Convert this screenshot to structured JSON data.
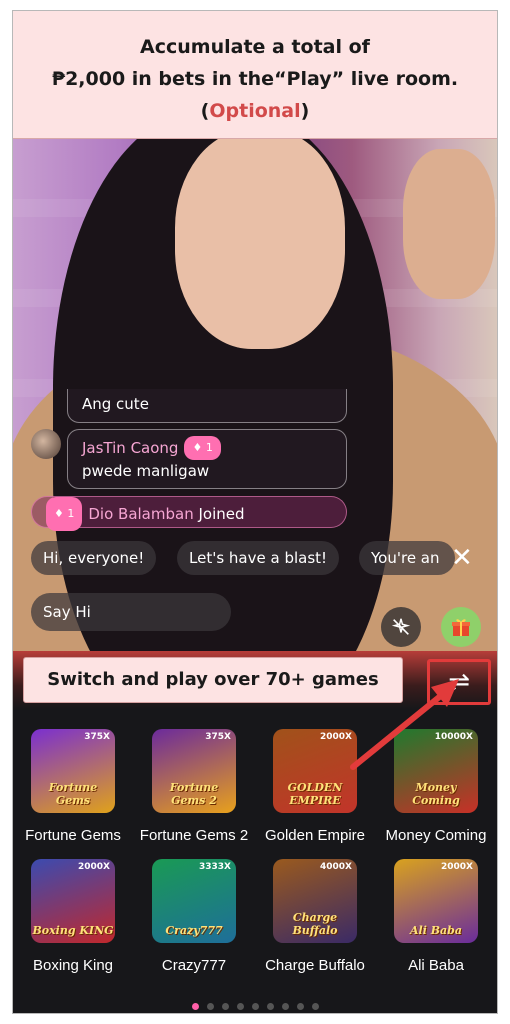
{
  "banner": {
    "line1": "Accumulate a total of",
    "line2": "₱2,000 in bets in the“Play” live room.",
    "line3_open": "(",
    "optional": "Optional",
    "line3_close": ")"
  },
  "chat": {
    "prev_message": "Ang cute",
    "message": {
      "user": "JasTin Caong",
      "level": "1",
      "text": "pwede manligaw"
    },
    "join": {
      "level": "1",
      "user": "Dio Balamban",
      "action": "Joined"
    }
  },
  "quick_replies": [
    "Hi, everyone!",
    "Let's have a blast!",
    "You're an"
  ],
  "close_label": "✕",
  "say_hi": "Say Hi",
  "game_panel": {
    "switch_label": "Switch and play over 70+ games",
    "switch_icon": "⇌",
    "games": [
      {
        "name": "Fortune Gems",
        "logo": "Fortune Gems",
        "tag": "375X",
        "color_top": "#7a2fd0",
        "color_bottom": "#e0a21a"
      },
      {
        "name": "Fortune Gems 2",
        "logo": "Fortune Gems 2",
        "tag": "375X",
        "color_top": "#6b2a9c",
        "color_bottom": "#e8a11c"
      },
      {
        "name": "Golden Empire",
        "logo": "GOLDEN EMPIRE",
        "tag": "2000X",
        "color_top": "#a0521a",
        "color_bottom": "#c2342a"
      },
      {
        "name": "Money Coming",
        "logo": "Money Coming",
        "tag": "10000X",
        "color_top": "#1f7a2e",
        "color_bottom": "#c93027"
      },
      {
        "name": "Boxing King",
        "logo": "Boxing KING",
        "tag": "2000X",
        "color_top": "#3b4bb0",
        "color_bottom": "#c1282c"
      },
      {
        "name": "Crazy777",
        "logo": "Crazy777",
        "tag": "3333X",
        "color_top": "#1a9a54",
        "color_bottom": "#1e6e9a"
      },
      {
        "name": "Charge Buffalo",
        "logo": "Charge Buffalo",
        "tag": "4000X",
        "color_top": "#9a5a1e",
        "color_bottom": "#3a2a66"
      },
      {
        "name": "Ali Baba",
        "logo": "Ali Baba",
        "tag": "2000X",
        "color_top": "#d9a21e",
        "color_bottom": "#6a2c9c"
      }
    ],
    "page_count": 9,
    "active_page": 0
  },
  "colors": {
    "accent_red": "#e23b3b",
    "banner_bg": "#fde3e3",
    "optional": "#d24a4a",
    "pink": "#ff6fb1"
  },
  "icons": {
    "close": "close-icon",
    "swap": "swap-icon",
    "effects": "sparkle-off-icon",
    "gift": "gift-icon"
  }
}
